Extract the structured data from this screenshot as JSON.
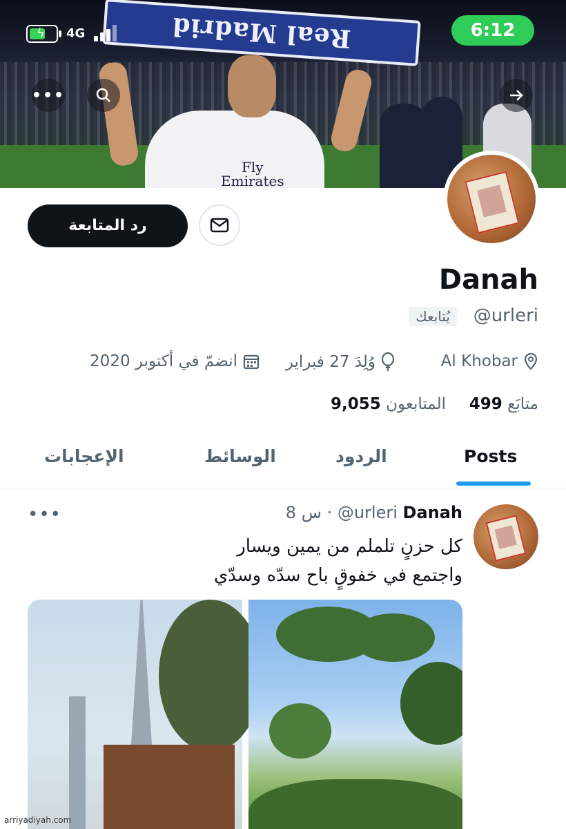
{
  "status_bar": {
    "network": "4G",
    "time": "6:12"
  },
  "banner": {
    "scarf_text": "Real Madrid",
    "sponsor_line1": "Fly",
    "sponsor_line2": "Emirates"
  },
  "actions": {
    "follow_back_label": "رد المتابعة",
    "message_icon": "envelope-icon"
  },
  "profile": {
    "name": "Danah",
    "handle": "@urleri",
    "follows_you": "يُتابعك",
    "location": "Al Khobar",
    "birthday": "وُلِدَ 27 فبراير",
    "joined": "انضمّ في أكتوبر 2020",
    "following_count": "499",
    "following_label": "متابَع",
    "followers_count": "9,055",
    "followers_label": "المتابعون"
  },
  "tabs": [
    {
      "label": "Posts",
      "active": true
    },
    {
      "label": "الردود",
      "active": false
    },
    {
      "label": "الوسائط",
      "active": false
    },
    {
      "label": "الإعجابات",
      "active": false
    }
  ],
  "post": {
    "author": "Danah",
    "handle": "@urleri",
    "separator": "·",
    "time": "8 س",
    "lines": [
      "كل حزنٍ تلملم من يمين ويسار",
      "واجتمع في خفوقٍ باح سدّه وسدّي"
    ]
  },
  "watermark": "arriyadiyah.com",
  "colors": {
    "accent": "#1d9bf0",
    "status_pill": "#2fcc59",
    "text": "#0f1419",
    "muted": "#536471"
  }
}
